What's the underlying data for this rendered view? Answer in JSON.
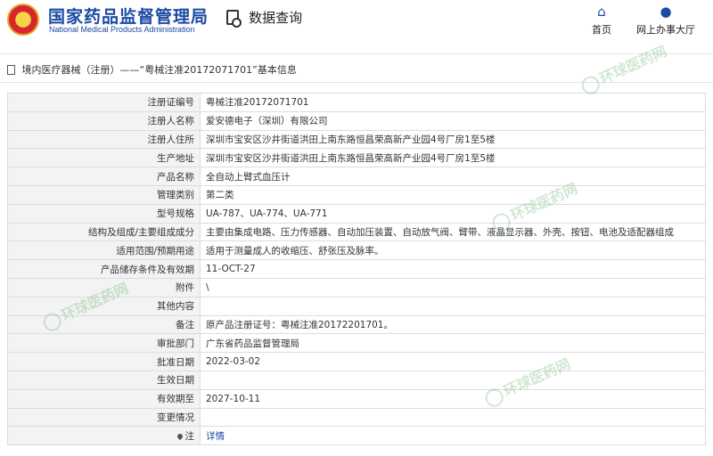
{
  "header": {
    "agency_name_cn": "国家药品监督管理局",
    "agency_name_en": "National Medical Products Administration",
    "page_title": "数据查询",
    "nav": [
      {
        "label": "首页",
        "icon": "home-icon"
      },
      {
        "label": "网上办事大厅",
        "icon": "user-icon"
      }
    ]
  },
  "breadcrumb": {
    "text": "境内医疗器械（注册）——“粤械注准20172071701”基本信息"
  },
  "details": [
    {
      "label": "注册证编号",
      "value": "粤械注准20172071701"
    },
    {
      "label": "注册人名称",
      "value": "爱安德电子（深圳）有限公司"
    },
    {
      "label": "注册人住所",
      "value": "深圳市宝安区沙井街道洪田上南东路恒昌荣高新产业园4号厂房1至5楼"
    },
    {
      "label": "生产地址",
      "value": "深圳市宝安区沙井街道洪田上南东路恒昌荣高新产业园4号厂房1至5楼"
    },
    {
      "label": "产品名称",
      "value": "全自动上臂式血压计"
    },
    {
      "label": "管理类别",
      "value": "第二类"
    },
    {
      "label": "型号规格",
      "value": "UA-787、UA-774、UA-771"
    },
    {
      "label": "结构及组成/主要组成成分",
      "value": "主要由集成电路、压力传感器、自动加压装置、自动放气阀、臂带、液晶显示器、外壳、按钮、电池及适配器组成"
    },
    {
      "label": "适用范围/预期用途",
      "value": "适用于测量成人的收缩压、舒张压及脉率。"
    },
    {
      "label": "产品储存条件及有效期",
      "value": "11-OCT-27"
    },
    {
      "label": "附件",
      "value": "\\"
    },
    {
      "label": "其他内容",
      "value": ""
    },
    {
      "label": "备注",
      "value": "原产品注册证号：粤械注准20172201701。"
    },
    {
      "label": "审批部门",
      "value": "广东省药品监督管理局"
    },
    {
      "label": "批准日期",
      "value": "2022-03-02"
    },
    {
      "label": "生效日期",
      "value": ""
    },
    {
      "label": "有效期至",
      "value": "2027-10-11"
    },
    {
      "label": "变更情况",
      "value": ""
    },
    {
      "label": "注",
      "value": "详情"
    }
  ],
  "watermark": {
    "text_cn": "环球医药网",
    "text_en": "WWW.QGYYZS.NET"
  }
}
